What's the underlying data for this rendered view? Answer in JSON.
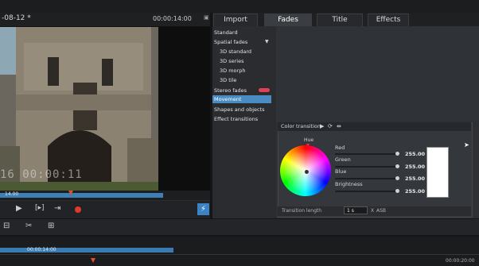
{
  "preview": {
    "title": "-08-12 *",
    "time": "00:00:14:00",
    "timecode_overlay": "16 00:00:11",
    "scrub_time": "14.00"
  },
  "tabs": [
    {
      "label": "Import",
      "active": false
    },
    {
      "label": "Fades",
      "active": true
    },
    {
      "label": "Title",
      "active": false
    },
    {
      "label": "Effects",
      "active": false
    }
  ],
  "fades": {
    "standard": "Standard",
    "spatial": "Spatial fades",
    "sub": [
      "3D standard",
      "3D series",
      "3D morph",
      "3D tile"
    ],
    "stereo": "Stereo fades",
    "movement": "Movement",
    "shapes": "Shapes and objects",
    "effect_transitions": "Effect transitions"
  },
  "color_transition": {
    "title": "Color transition",
    "hue_label": "Hue",
    "sliders": [
      {
        "label": "Red",
        "value": "255.00",
        "level": 1.0
      },
      {
        "label": "Green",
        "value": "255.00",
        "level": 1.0
      },
      {
        "label": "Blue",
        "value": "255.00",
        "level": 1.0
      },
      {
        "label": "Brightness",
        "value": "255.00",
        "level": 1.0
      }
    ],
    "swatch_color": "#ffffff",
    "transition_length_label": "Transition length",
    "transition_length_value": "1 s",
    "transition_x": "X",
    "transition_asb": "ASB"
  },
  "timeline": {
    "range_label": "00:00:14:00",
    "end_label": "00:00:20:00"
  },
  "colors": {
    "accent": "#3b84c4",
    "record": "#e03a2a",
    "marker": "#e0502b",
    "stereo_badge": "#e0405a"
  }
}
